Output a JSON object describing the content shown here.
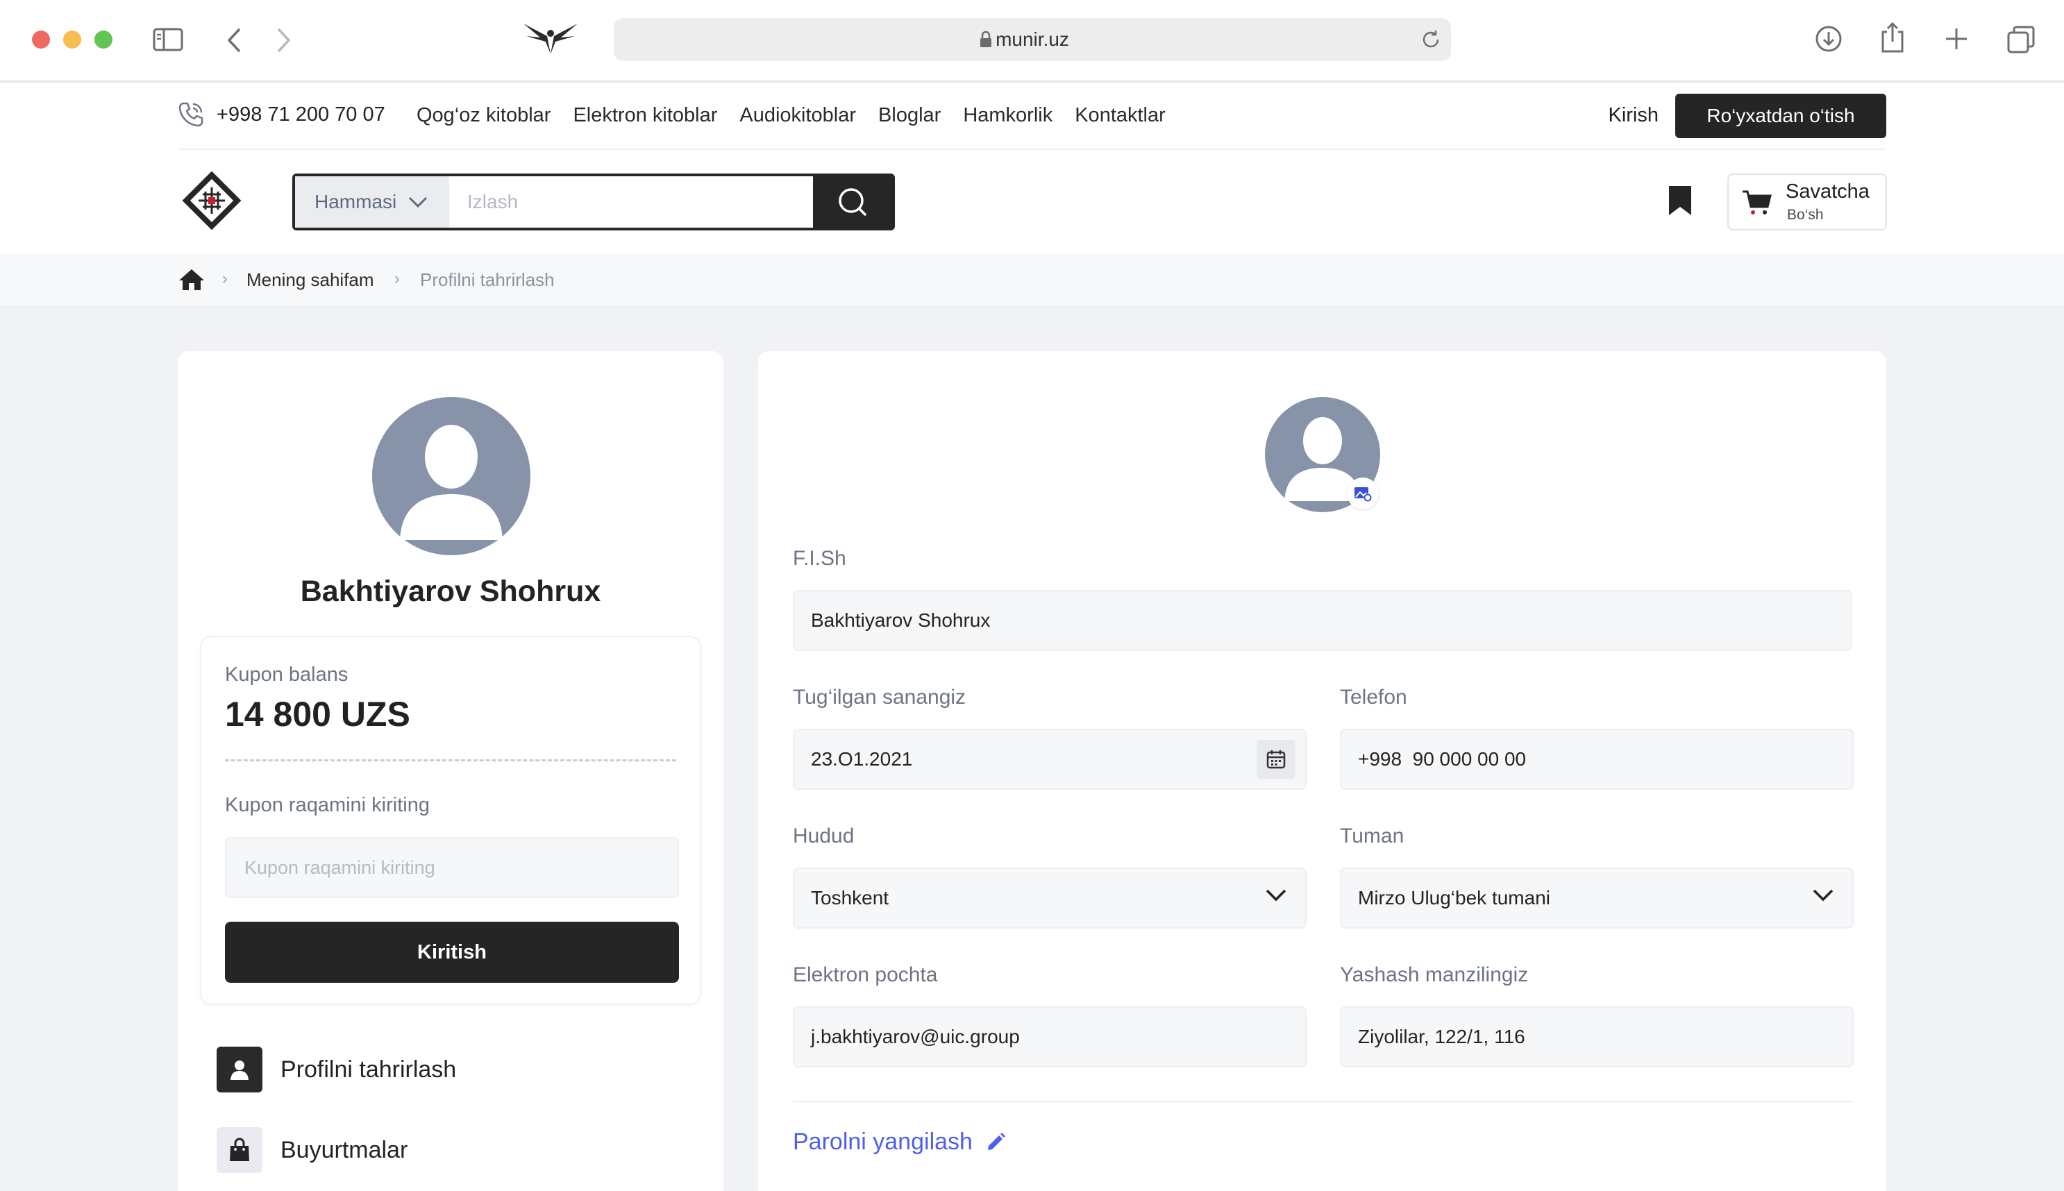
{
  "browser": {
    "url": "munir.uz"
  },
  "topbar": {
    "phone": "+998 71 200 70 07",
    "nav": [
      "Qog‘oz kitoblar",
      "Elektron kitoblar",
      "Audiokitoblar",
      "Bloglar",
      "Hamkorlik",
      "Kontaktlar"
    ],
    "login_label": "Kirish",
    "signup_label": "Ro‘yxatdan o‘tish"
  },
  "header": {
    "search_category": "Hammasi",
    "search_placeholder": "Izlash",
    "cart_title": "Savatcha",
    "cart_status": "Bo‘sh"
  },
  "breadcrumb": {
    "items": [
      "Mening sahifam",
      "Profilni tahrirlash"
    ]
  },
  "profile": {
    "name": "Bakhtiyarov Shohrux"
  },
  "coupon": {
    "balance_label": "Kupon balans",
    "balance_value": "14 800 UZS",
    "enter_label": "Kupon raqamini kiriting",
    "input_placeholder": "Kupon raqamini kiriting",
    "submit_label": "Kiritish"
  },
  "side_menu": [
    {
      "label": "Profilni tahrirlash",
      "icon": "user-icon"
    },
    {
      "label": "Buyurtmalar",
      "icon": "shopping-bag-icon"
    }
  ],
  "form": {
    "fullname_label": "F.I.Sh",
    "fullname_value": "Bakhtiyarov Shohrux",
    "birthdate_label": "Tug‘ilgan sanangiz",
    "birthdate_value": "23.O1.2021",
    "phone_label": "Telefon",
    "phone_value": "+998  90 000 00 00",
    "region_label": "Hudud",
    "region_value": "Toshkent",
    "district_label": "Tuman",
    "district_value": "Mirzo Ulug‘bek tumani",
    "email_label": "Elektron pochta",
    "email_value": "j.bakhtiyarov@uic.group",
    "address_label": "Yashash manzilingiz",
    "address_value": "Ziyolilar, 122/1, 116",
    "password_link": "Parolni yangilash"
  },
  "colors": {
    "primary_dark": "#252525",
    "link_blue": "#4e5ff0",
    "avatar_gray": "#8693a8",
    "page_bg": "#f1f2f6"
  }
}
